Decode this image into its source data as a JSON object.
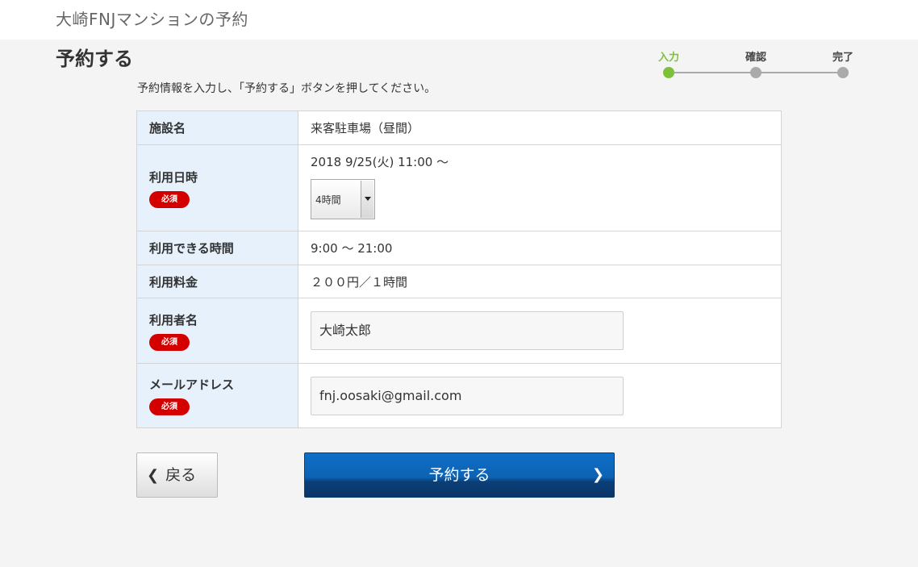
{
  "header": {
    "site_title": "大崎FNJマンションの予約"
  },
  "page": {
    "title": "予約する",
    "instruction": "予約情報を入力し、「予約する」ボタンを押してください。"
  },
  "steps": [
    {
      "label": "入力",
      "active": true
    },
    {
      "label": "確認",
      "active": false
    },
    {
      "label": "完了",
      "active": false
    }
  ],
  "form": {
    "required_badge": "必須",
    "facility": {
      "label": "施設名",
      "value": "来客駐車場（昼間）"
    },
    "usage_datetime": {
      "label": "利用日時",
      "start": "2018 9/25(火) 11:00 ～",
      "duration_selected": "4時間"
    },
    "available_hours": {
      "label": "利用できる時間",
      "value": "9:00 ～ 21:00"
    },
    "fee": {
      "label": "利用料金",
      "value": "２００円／１時間"
    },
    "user_name": {
      "label": "利用者名",
      "value": "大崎太郎"
    },
    "email": {
      "label": "メールアドレス",
      "value": "fnj.oosaki@gmail.com"
    }
  },
  "buttons": {
    "back_label": "戻る",
    "submit_label": "予約する"
  },
  "colors": {
    "accent_green": "#7dc13a",
    "required_red": "#d40000",
    "header_cell_blue": "#e6f1fc",
    "submit_blue": "#0d62b3"
  }
}
